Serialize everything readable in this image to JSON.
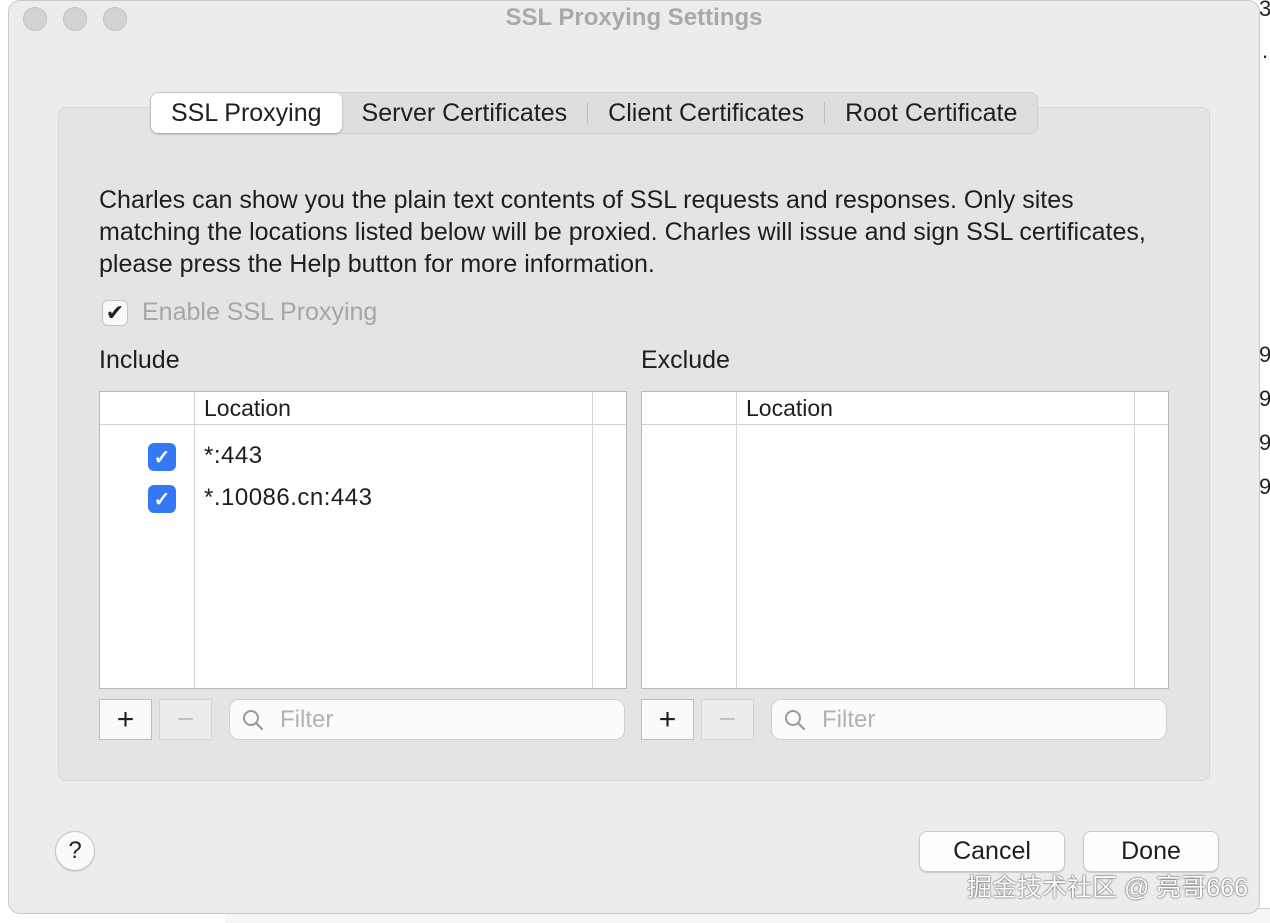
{
  "window": {
    "title": "SSL Proxying Settings"
  },
  "tabs": [
    {
      "label": "SSL Proxying",
      "active": true
    },
    {
      "label": "Server Certificates",
      "active": false
    },
    {
      "label": "Client Certificates",
      "active": false
    },
    {
      "label": "Root Certificate",
      "active": false
    }
  ],
  "description": "Charles can show you the plain text contents of SSL requests and responses. Only sites matching the locations listed below will be proxied. Charles will issue and sign SSL certificates, please press the Help button for more information.",
  "enable_ssl": {
    "label": "Enable SSL Proxying",
    "checked": true,
    "enabled": false
  },
  "include": {
    "label": "Include",
    "column": "Location",
    "rows": [
      {
        "location": "*:443",
        "checked": true
      },
      {
        "location": "*.10086.cn:443",
        "checked": true
      }
    ],
    "add_label": "+",
    "remove_label": "−",
    "filter_placeholder": "Filter"
  },
  "exclude": {
    "label": "Exclude",
    "column": "Location",
    "rows": [],
    "add_label": "+",
    "remove_label": "−",
    "filter_placeholder": "Filter"
  },
  "buttons": {
    "help": "?",
    "cancel": "Cancel",
    "done": "Done"
  },
  "watermark": "掘金技术社区 @ 亮哥666",
  "accent_color": "#3478f6",
  "icons": [
    "close-button",
    "minimize-button",
    "zoom-button",
    "search-icon",
    "checkmark-icon",
    "help-icon"
  ]
}
